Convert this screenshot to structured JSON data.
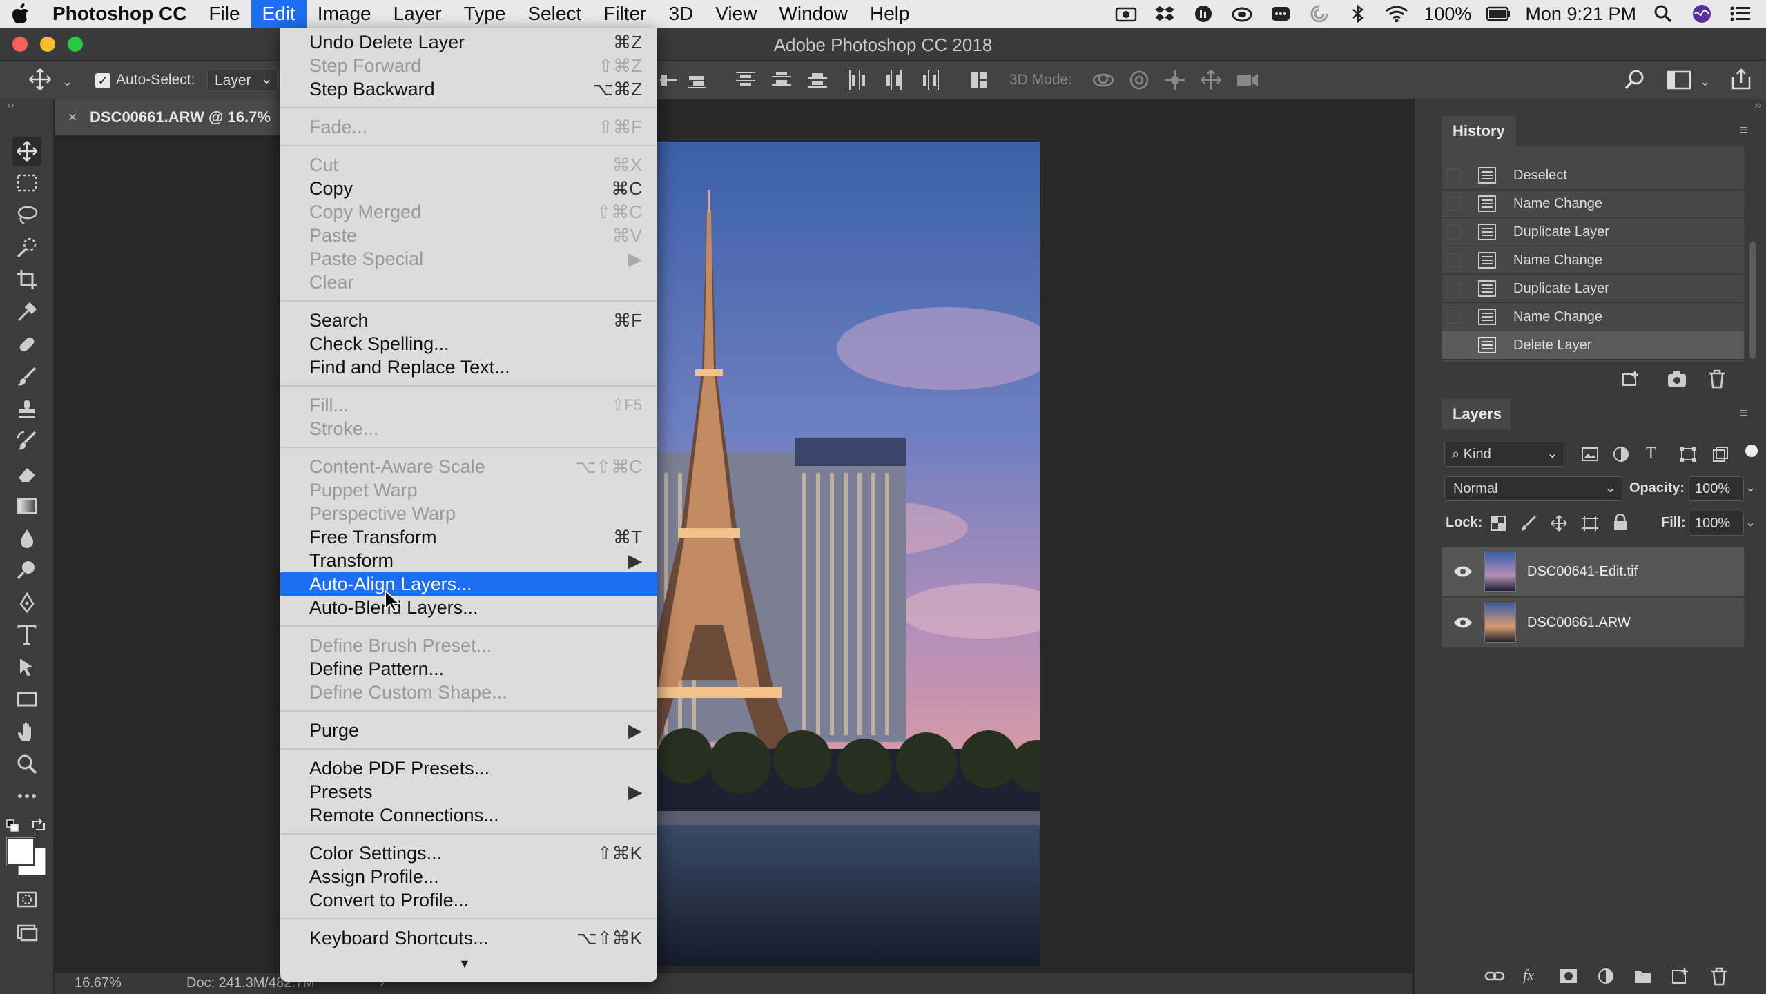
{
  "menubar": {
    "app": "Photoshop CC",
    "items": [
      "File",
      "Edit",
      "Image",
      "Layer",
      "Type",
      "Select",
      "Filter",
      "3D",
      "View",
      "Window",
      "Help"
    ],
    "battery": "100%",
    "clock": "Mon 9:21 PM"
  },
  "window": {
    "title": "Adobe Photoshop CC 2018"
  },
  "options": {
    "auto_select_label": "Auto-Select:",
    "auto_select_value": "Layer",
    "mode_3d_label": "3D Mode:"
  },
  "document": {
    "tab_title": "DSC00661.ARW @ 16.7%"
  },
  "status": {
    "zoom": "16.67%",
    "doc": "Doc: 241.3M/482.7M"
  },
  "edit_menu": {
    "items": [
      {
        "label": "Undo Delete Layer",
        "shortcut": "⌘Z",
        "disabled": false
      },
      {
        "label": "Step Forward",
        "shortcut": "⇧⌘Z",
        "disabled": true
      },
      {
        "label": "Step Backward",
        "shortcut": "⌥⌘Z",
        "disabled": false
      },
      {
        "label": "Fade...",
        "shortcut": "⇧⌘F",
        "disabled": true
      },
      {
        "label": "Cut",
        "shortcut": "⌘X",
        "disabled": true
      },
      {
        "label": "Copy",
        "shortcut": "⌘C",
        "disabled": false
      },
      {
        "label": "Copy Merged",
        "shortcut": "⇧⌘C",
        "disabled": true
      },
      {
        "label": "Paste",
        "shortcut": "⌘V",
        "disabled": true
      },
      {
        "label": "Paste Special",
        "shortcut": "▶",
        "disabled": true
      },
      {
        "label": "Clear",
        "shortcut": "",
        "disabled": true
      },
      {
        "label": "Search",
        "shortcut": "⌘F",
        "disabled": false
      },
      {
        "label": "Check Spelling...",
        "shortcut": "",
        "disabled": false
      },
      {
        "label": "Find and Replace Text...",
        "shortcut": "",
        "disabled": false
      },
      {
        "label": "Fill...",
        "shortcut": "⇧F5",
        "disabled": true
      },
      {
        "label": "Stroke...",
        "shortcut": "",
        "disabled": true
      },
      {
        "label": "Content-Aware Scale",
        "shortcut": "⌥⇧⌘C",
        "disabled": true
      },
      {
        "label": "Puppet Warp",
        "shortcut": "",
        "disabled": true
      },
      {
        "label": "Perspective Warp",
        "shortcut": "",
        "disabled": true
      },
      {
        "label": "Free Transform",
        "shortcut": "⌘T",
        "disabled": false
      },
      {
        "label": "Transform",
        "shortcut": "▶",
        "disabled": false
      },
      {
        "label": "Auto-Align Layers...",
        "shortcut": "",
        "disabled": false,
        "highlighted": true
      },
      {
        "label": "Auto-Blend Layers...",
        "shortcut": "",
        "disabled": false
      },
      {
        "label": "Define Brush Preset...",
        "shortcut": "",
        "disabled": true
      },
      {
        "label": "Define Pattern...",
        "shortcut": "",
        "disabled": false
      },
      {
        "label": "Define Custom Shape...",
        "shortcut": "",
        "disabled": true
      },
      {
        "label": "Purge",
        "shortcut": "▶",
        "disabled": false
      },
      {
        "label": "Adobe PDF Presets...",
        "shortcut": "",
        "disabled": false
      },
      {
        "label": "Presets",
        "shortcut": "▶",
        "disabled": false
      },
      {
        "label": "Remote Connections...",
        "shortcut": "",
        "disabled": false
      },
      {
        "label": "Color Settings...",
        "shortcut": "⇧⌘K",
        "disabled": false
      },
      {
        "label": "Assign Profile...",
        "shortcut": "",
        "disabled": false
      },
      {
        "label": "Convert to Profile...",
        "shortcut": "",
        "disabled": false
      },
      {
        "label": "Keyboard Shortcuts...",
        "shortcut": "⌥⇧⌘K",
        "disabled": false
      }
    ]
  },
  "history": {
    "title": "History",
    "items": [
      "Deselect",
      "Name Change",
      "Duplicate Layer",
      "Name Change",
      "Duplicate Layer",
      "Name Change",
      "Delete Layer"
    ]
  },
  "layers": {
    "title": "Layers",
    "filter": "Kind",
    "blend_mode": "Normal",
    "opacity_label": "Opacity:",
    "opacity": "100%",
    "lock_label": "Lock:",
    "fill_label": "Fill:",
    "fill": "100%",
    "items": [
      "DSC00641-Edit.tif",
      "DSC00661.ARW"
    ]
  },
  "colors": {
    "accent": "#1c6ef2",
    "menu_bg": "#dcdcdc",
    "panel_bg": "#3a3a3a"
  }
}
